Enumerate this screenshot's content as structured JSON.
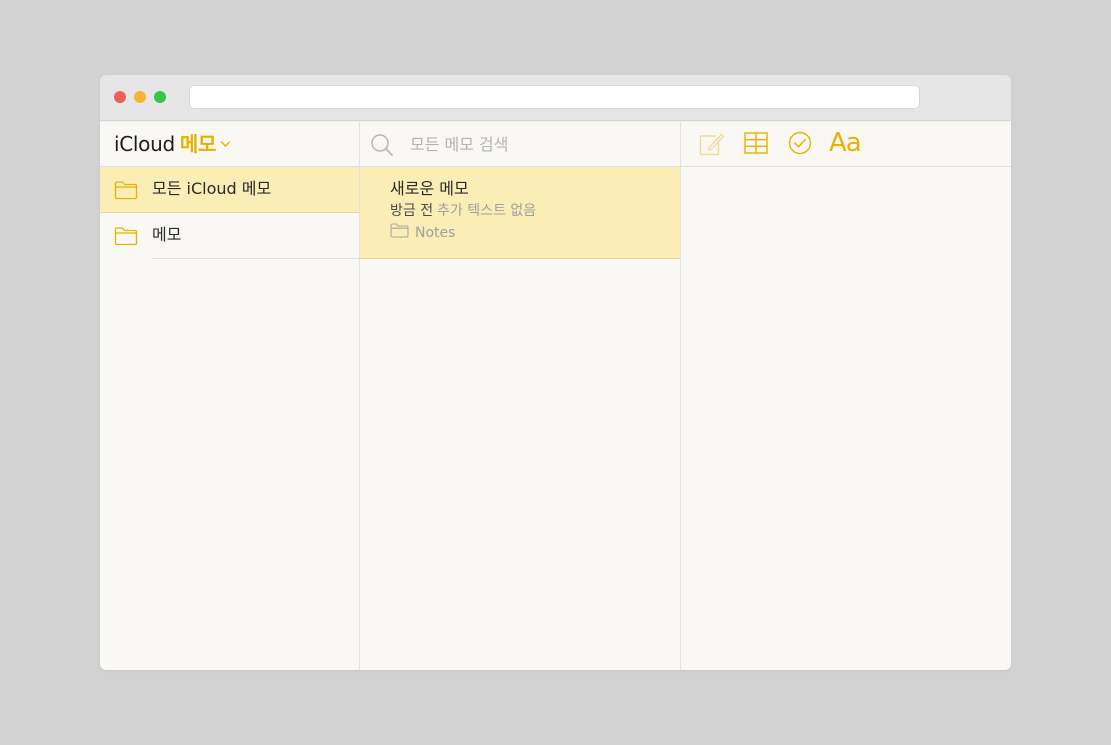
{
  "window": {
    "traffic_lights": {
      "close": "#f25d57",
      "minimize": "#f4b630",
      "zoom": "#33c748"
    },
    "address_bar_value": ""
  },
  "sidebar": {
    "brand_icloud": "iCloud",
    "brand_memo": "메모",
    "folders": [
      {
        "label": "모든 iCloud 메모",
        "selected": true,
        "icon": "folder-icon"
      },
      {
        "label": "메모",
        "selected": false,
        "icon": "folder-icon"
      }
    ]
  },
  "search": {
    "placeholder": "모든 메모 검색",
    "icon": "search-icon"
  },
  "notes": [
    {
      "title": "새로운 메모",
      "time": "방금 전",
      "preview": "추가 텍스트 없음",
      "folder": "Notes",
      "selected": true
    }
  ],
  "editor_toolbar": {
    "compose_icon": "compose-icon",
    "table_icon": "table-icon",
    "checklist_icon": "checklist-icon",
    "format_label": "Aa"
  },
  "colors": {
    "accent": "#e1b400",
    "selection": "#faedb5",
    "background": "#f9f8f5"
  }
}
